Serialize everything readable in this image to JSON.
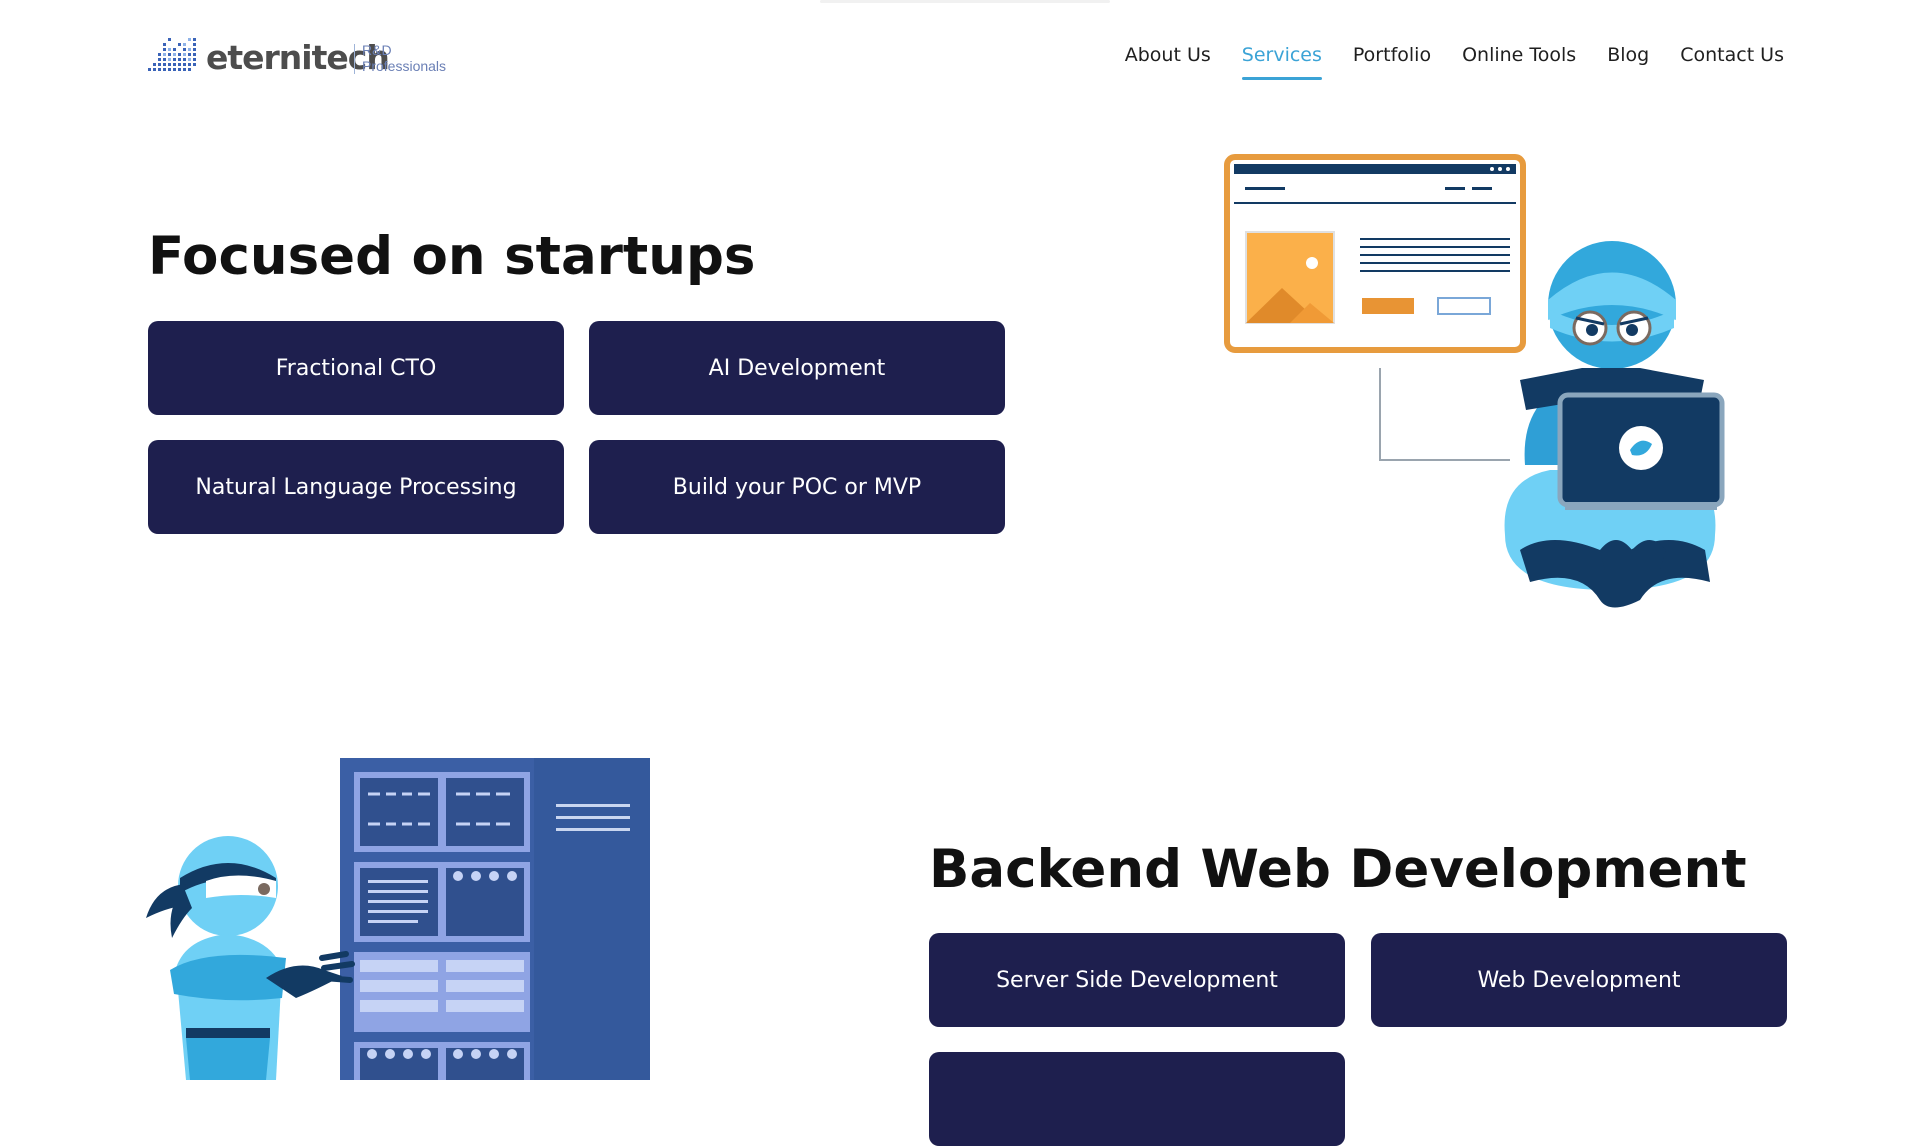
{
  "header": {
    "logo": {
      "name": "eternitech",
      "tagline_line1": "R&D",
      "tagline_line2": "Professionals"
    },
    "nav": [
      {
        "label": "About Us",
        "active": false
      },
      {
        "label": "Services",
        "active": true
      },
      {
        "label": "Portfolio",
        "active": false
      },
      {
        "label": "Online Tools",
        "active": false
      },
      {
        "label": "Blog",
        "active": false
      },
      {
        "label": "Contact Us",
        "active": false
      }
    ]
  },
  "sections": [
    {
      "title": "Focused on startups",
      "buttons": [
        "Fractional CTO",
        "AI Development",
        "Natural Language Processing",
        "Build your POC or MVP"
      ]
    },
    {
      "title": "Backend Web Development",
      "buttons": [
        "Server Side Development",
        "Web Development",
        ""
      ]
    }
  ],
  "colors": {
    "button_bg": "#1e1f4e",
    "accent": "#3ba3d6",
    "text": "#111111"
  },
  "icons": [
    "logo-mark-icon",
    "ninja-laptop-illustration",
    "ninja-server-illustration",
    "twitter-bird-icon"
  ]
}
